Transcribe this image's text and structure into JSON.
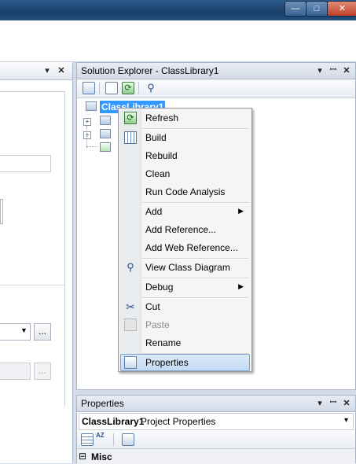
{
  "window": {
    "minimize_glyph": "—",
    "maximize_glyph": "□",
    "close_glyph": "✕"
  },
  "left_panel": {
    "pin_glyph": "▾",
    "close_glyph": "✕",
    "ellipsis": "..."
  },
  "solution_explorer": {
    "title": "Solution Explorer - ClassLibrary1",
    "dropdown_glyph": "▾",
    "pin_glyph": "ꟷ",
    "close_glyph": "✕",
    "toolbar_icons": [
      "properties-icon",
      "show-all-files-icon",
      "refresh-icon",
      "class-diagram-icon"
    ],
    "tree": {
      "root": "ClassLibrary1"
    }
  },
  "context_menu": {
    "groups": [
      [
        {
          "label": "Refresh",
          "icon": "refresh-icon"
        }
      ],
      [
        {
          "label": "Build",
          "icon": "build-icon"
        },
        {
          "label": "Rebuild"
        },
        {
          "label": "Clean"
        },
        {
          "label": "Run Code Analysis"
        }
      ],
      [
        {
          "label": "Add",
          "submenu": true
        },
        {
          "label": "Add Reference..."
        },
        {
          "label": "Add Web Reference..."
        }
      ],
      [
        {
          "label": "View Class Diagram",
          "icon": "class-diagram-icon"
        }
      ],
      [
        {
          "label": "Debug",
          "submenu": true
        }
      ],
      [
        {
          "label": "Cut",
          "icon": "cut-icon"
        },
        {
          "label": "Paste",
          "icon": "paste-icon",
          "disabled": true
        },
        {
          "label": "Rename"
        }
      ],
      [
        {
          "label": "Properties",
          "icon": "properties-icon",
          "highlighted": true
        }
      ]
    ],
    "submenu_glyph": "▶"
  },
  "properties": {
    "title": "Properties",
    "dropdown_glyph": "▾",
    "pin_glyph": "ꟷ",
    "close_glyph": "✕",
    "object_name": "ClassLibrary1",
    "object_type": "Project Properties",
    "selector_glyph": "▾",
    "toolbar_icons": [
      "categorized-icon",
      "alphabetical-icon",
      "property-pages-icon"
    ],
    "alphabetical_text": "AZ",
    "category": "Misc",
    "collapse_glyph": "⊟"
  }
}
